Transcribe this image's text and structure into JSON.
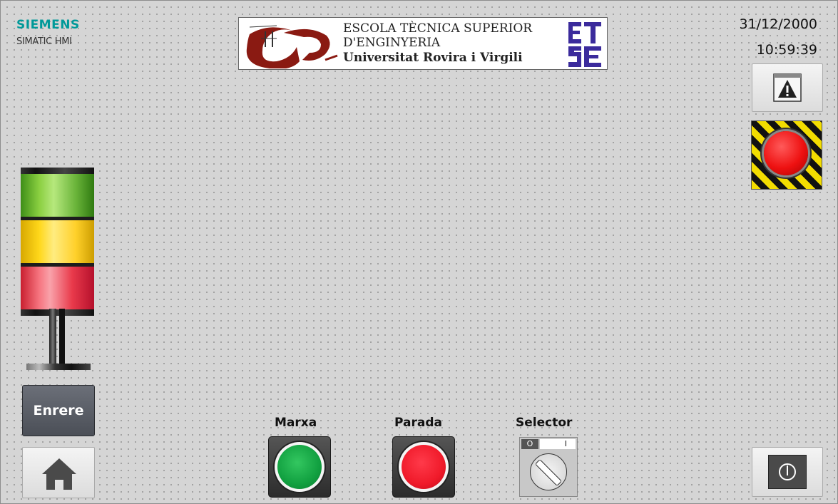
{
  "branding": {
    "brand": "SIEMENS",
    "product": "SIMATIC HMI"
  },
  "header_logo": {
    "line1": "ESCOLA TÈCNICA SUPERIOR",
    "line2": "D'ENGINYERIA",
    "line3": "Universitat Rovira i Virgili",
    "mark_top": "ET",
    "mark_bottom": "SE"
  },
  "status": {
    "date": "31/12/2000",
    "time": "10:59:39"
  },
  "stack_light": {
    "segments": [
      "green",
      "yellow",
      "red"
    ]
  },
  "buttons": {
    "back": "Enrere",
    "alarm_window_icon": "warning-icon",
    "emergency_stop_icon": "emergency-stop-icon",
    "home_icon": "home-icon",
    "power_icon": "power-icon"
  },
  "controls": {
    "marxa": {
      "label": "Marxa",
      "color": "#11a040"
    },
    "parada": {
      "label": "Parada",
      "color": "#f01a2a"
    },
    "selector": {
      "label": "Selector",
      "pos0": "O",
      "pos1": "I"
    }
  },
  "colors": {
    "brand": "#009999",
    "background": "#d5d5d5",
    "logo_purple": "#3b2b9c",
    "logo_red": "#8a1a12"
  }
}
